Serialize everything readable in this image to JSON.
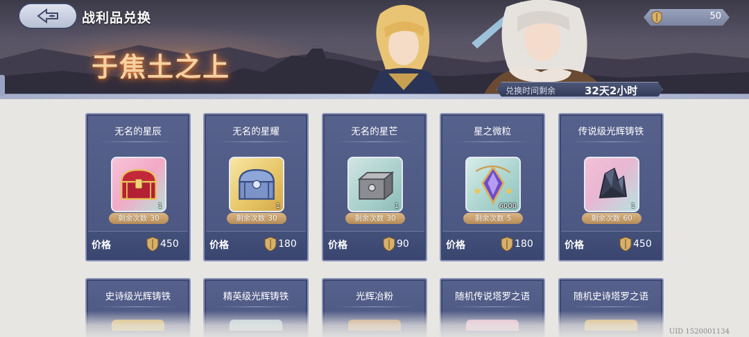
{
  "header": {
    "title": "战利品兑换",
    "event_title": "于焦土之上",
    "currency_value": "50",
    "timer_label": "兑换时间剩余",
    "timer_value": "32天2小时"
  },
  "shop": {
    "price_label": "价格",
    "remaining_label": "剩余次数",
    "items": [
      {
        "name": "无名的星辰",
        "qty": "1",
        "remaining": "30",
        "price": "450",
        "icon": "red-treasure-chest-icon"
      },
      {
        "name": "无名的星耀",
        "qty": "1",
        "remaining": "30",
        "price": "180",
        "icon": "blue-treasure-chest-icon"
      },
      {
        "name": "无名的星芒",
        "qty": "1",
        "remaining": "30",
        "price": "90",
        "icon": "grey-treasure-chest-icon"
      },
      {
        "name": "星之微粒",
        "qty": "6000",
        "remaining": "5",
        "price": "180",
        "icon": "star-crystal-pendant-icon"
      },
      {
        "name": "传说级光辉铸铁",
        "qty": "1",
        "remaining": "60",
        "price": "450",
        "icon": "dark-ore-crystal-icon"
      }
    ],
    "items_row2": [
      {
        "name": "史诗级光辉铸铁"
      },
      {
        "name": "精英级光辉铸铁"
      },
      {
        "name": "光辉冶粉"
      },
      {
        "name": "随机传说塔罗之语"
      },
      {
        "name": "随机史诗塔罗之语"
      }
    ]
  },
  "footer": {
    "uid": "UID 1520001134"
  },
  "colors": {
    "card_bg": "#4e5985",
    "remain_badge": "#c9a06a",
    "banner_strip": "#b4bcd5"
  }
}
